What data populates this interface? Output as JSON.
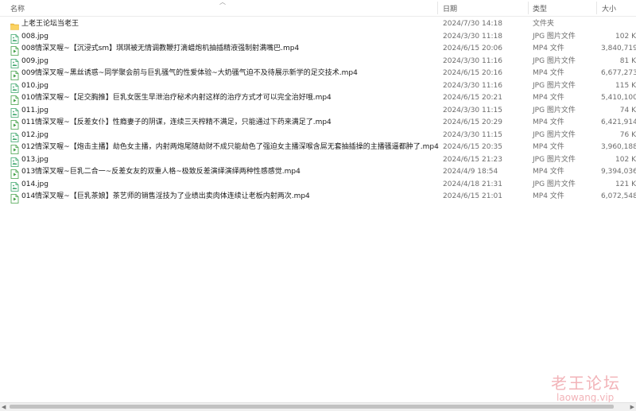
{
  "columns": {
    "name": "名称",
    "date": "日期",
    "type": "类型",
    "size": "大小"
  },
  "files": [
    {
      "icon": "folder-icon",
      "name": "上老王论坛当老王",
      "date": "2024/7/30 14:18",
      "type": "文件夹",
      "size": ""
    },
    {
      "icon": "image-file-icon",
      "name": "008.jpg",
      "date": "2024/3/30 11:18",
      "type": "JPG 图片文件",
      "size": "102 K"
    },
    {
      "icon": "video-file-icon",
      "name": "008情深叉喔~【沉浸式sm】琪琪被无情调教鞭打滴蜡炮机抽插精液强制射满嘴巴.mp4",
      "date": "2024/6/15 20:06",
      "type": "MP4 文件",
      "size": "3,840,719,"
    },
    {
      "icon": "image-file-icon",
      "name": "009.jpg",
      "date": "2024/3/30 11:16",
      "type": "JPG 图片文件",
      "size": "81 K"
    },
    {
      "icon": "video-file-icon",
      "name": "009情深叉喔~黑丝诱惑~同学聚会前与巨乳骚气的性爱体验~大奶骚气迫不及待展示新学的足交技术.mp4",
      "date": "2024/6/15 20:16",
      "type": "MP4 文件",
      "size": "6,677,273,"
    },
    {
      "icon": "image-file-icon",
      "name": "010.jpg",
      "date": "2024/3/30 11:16",
      "type": "JPG 图片文件",
      "size": "115 K"
    },
    {
      "icon": "video-file-icon",
      "name": "010情深叉喔~【足交胸推】巨乳女医生早泄治疗秘术内射这样的治疗方式才可以完全治好哦.mp4",
      "date": "2024/6/15 20:21",
      "type": "MP4 文件",
      "size": "5,410,100,"
    },
    {
      "icon": "image-file-icon",
      "name": "011.jpg",
      "date": "2024/3/30 11:15",
      "type": "JPG 图片文件",
      "size": "74 K"
    },
    {
      "icon": "video-file-icon",
      "name": "011情深叉喔~【反差女仆】性瘾妻子的阴谋，连续三天榨精不满足，只能通过下药来满足了.mp4",
      "date": "2024/6/15 20:29",
      "type": "MP4 文件",
      "size": "6,421,914,"
    },
    {
      "icon": "image-file-icon",
      "name": "012.jpg",
      "date": "2024/3/30 11:15",
      "type": "JPG 图片文件",
      "size": "76 K"
    },
    {
      "icon": "video-file-icon",
      "name": "012情深叉喔~【炮击主播】劫色女主播，内射两炮尾随劫财不成只能劫色了强迫女主播深喉含屌无套抽插操的主播骚逼都肿了.mp4",
      "date": "2024/6/15 20:35",
      "type": "MP4 文件",
      "size": "3,960,188,"
    },
    {
      "icon": "image-file-icon",
      "name": "013.jpg",
      "date": "2024/6/15 21:23",
      "type": "JPG 图片文件",
      "size": "102 K"
    },
    {
      "icon": "video-file-icon",
      "name": "013情深叉喔~巨乳二合一~反差女友的双重人格~极致反差演绎演绎两种性感感觉.mp4",
      "date": "2024/4/9 18:54",
      "type": "MP4 文件",
      "size": "9,394,036,"
    },
    {
      "icon": "image-file-icon",
      "name": "014.jpg",
      "date": "2024/4/18 21:31",
      "type": "JPG 图片文件",
      "size": "121 K"
    },
    {
      "icon": "video-file-icon",
      "name": "014情深叉喔~【巨乳茶娘】茶艺师的销售淫技为了业绩出卖肉体连续让老板内射两次.mp4",
      "date": "2024/6/15 21:01",
      "type": "MP4 文件",
      "size": "6,072,548,"
    }
  ],
  "watermark": {
    "title": "老王论坛",
    "url": "laowang.vip"
  },
  "colors": {
    "accent": "#0078d7",
    "watermark": "#f2b3b8",
    "folder": "#f5c242",
    "image_icon": "#3aa56a",
    "video_icon": "#4caf50"
  }
}
